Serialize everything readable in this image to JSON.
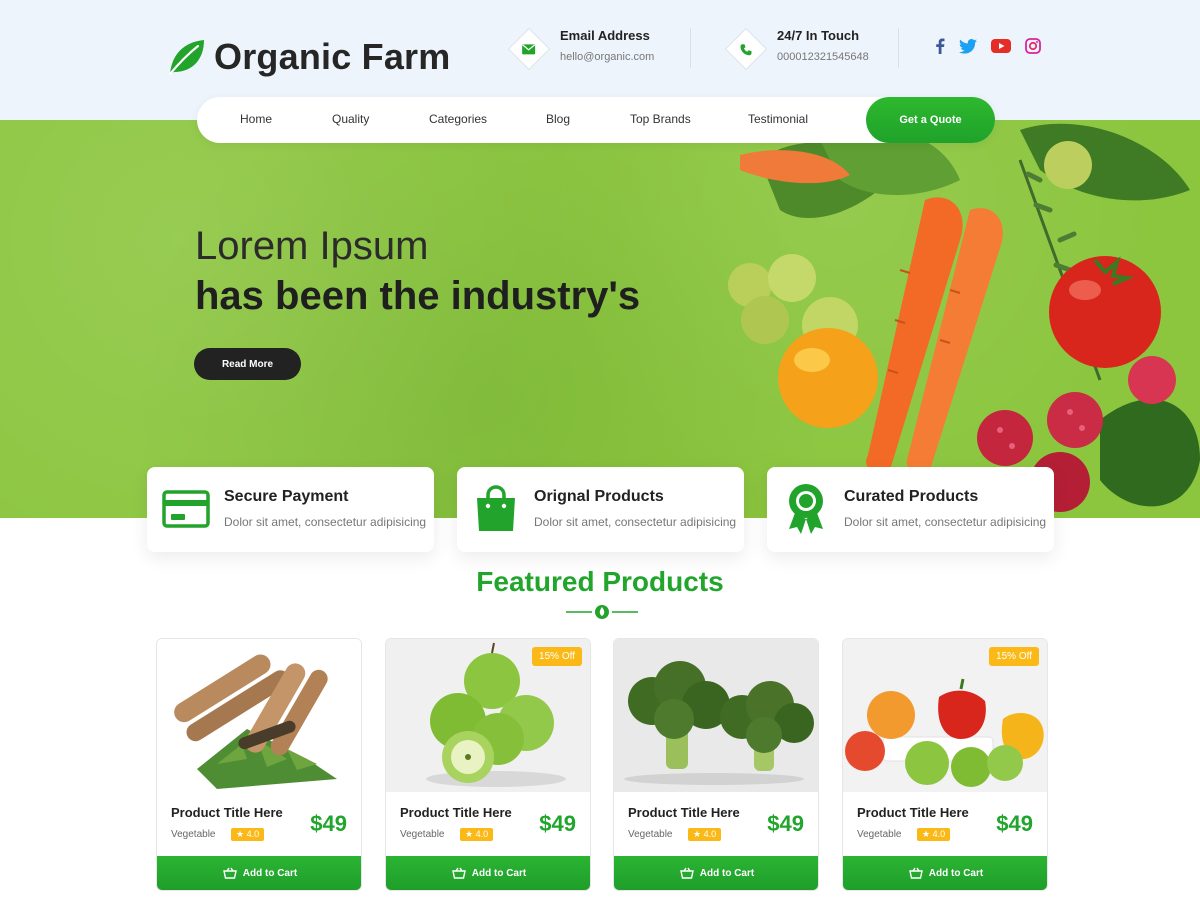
{
  "brand": {
    "name": "Organic Farm"
  },
  "contacts": [
    {
      "title": "Email Address",
      "value": "hello@organic.com",
      "icon": "mail-icon"
    },
    {
      "title": "24/7 In Touch",
      "value": "000012321545648",
      "icon": "phone-icon"
    }
  ],
  "social": [
    "facebook-icon",
    "twitter-icon",
    "youtube-icon",
    "instagram-icon"
  ],
  "nav": {
    "items": [
      "Home",
      "Quality",
      "Categories",
      "Blog",
      "Top Brands",
      "Testimonial"
    ],
    "cta": "Get a Quote"
  },
  "hero": {
    "line1": "Lorem Ipsum",
    "line2": "has been the industry's",
    "button": "Read More"
  },
  "features": [
    {
      "title": "Secure Payment",
      "desc": "Dolor sit amet, consectetur adipisicing",
      "icon": "credit-card-icon"
    },
    {
      "title": "Orignal Products",
      "desc": "Dolor sit amet, consectetur adipisicing",
      "icon": "shopping-bag-icon"
    },
    {
      "title": "Curated Products",
      "desc": "Dolor sit amet, consectetur adipisicing",
      "icon": "award-badge-icon"
    }
  ],
  "featured": {
    "title": "Featured Products",
    "products": [
      {
        "title": "Product Title Here",
        "category": "Vegetable",
        "rating": "★ 4.0",
        "price": "$49",
        "badge": "",
        "cart": "Add to Cart"
      },
      {
        "title": "Product Title Here",
        "category": "Vegetable",
        "rating": "★ 4.0",
        "price": "$49",
        "badge": "15% Off",
        "cart": "Add to Cart"
      },
      {
        "title": "Product Title Here",
        "category": "Vegetable",
        "rating": "★ 4.0",
        "price": "$49",
        "badge": "",
        "cart": "Add to Cart"
      },
      {
        "title": "Product Title Here",
        "category": "Vegetable",
        "rating": "★ 4.0",
        "price": "$49",
        "badge": "15% Off",
        "cart": "Add to Cart"
      }
    ]
  },
  "colors": {
    "accent": "#21a52c",
    "hero": "#8cc63f",
    "badge": "#fbb917",
    "topbar": "#eef4fc"
  }
}
